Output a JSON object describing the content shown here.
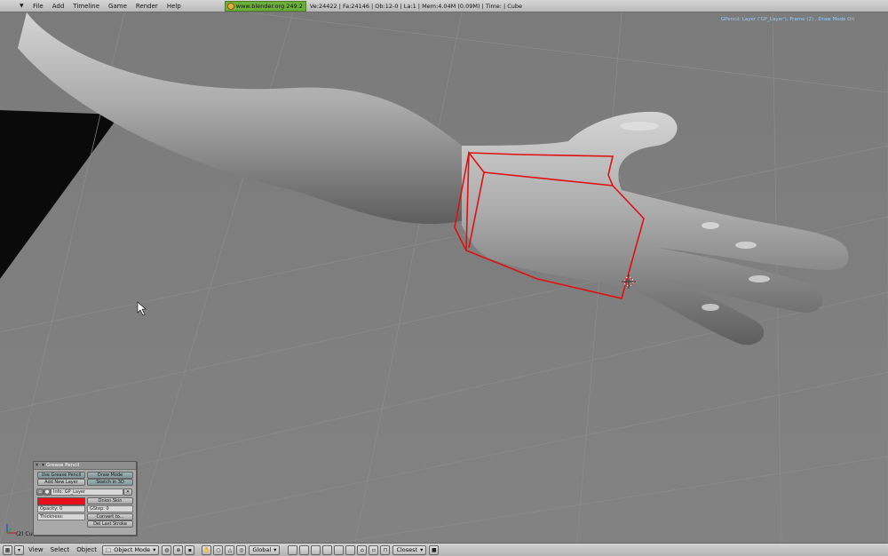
{
  "menu": {
    "items": [
      "File",
      "Add",
      "Timeline",
      "Game",
      "Render",
      "Help"
    ]
  },
  "status": {
    "url": "www.blender.org 249.2",
    "stats": "Ve:24422 | Fa:24146 | Ob:12-0 | La:1  | Mem:4.04M (0.09M)  | Time: | Cube"
  },
  "viewport": {
    "gp_info": "GPencil: Layer ('GP_Layer'), Frame (2) , Draw Mode On",
    "object_label": "(2) Cube",
    "annotation_color": "#e01010"
  },
  "gp_panel": {
    "title": "Grease Pencil",
    "use_label": "Use Grease Pencil",
    "draw_mode_label": "Draw Mode",
    "add_layer_label": "Add New Layer",
    "sketch_3d_label": "Sketch in 3D",
    "info_label": "Info: GP_Layer",
    "onion_skin_label": "Onion Skin",
    "opacity_label": "Opacity: 0",
    "gstep_label": "GStep: 0",
    "thickness_label": "Thickness: ",
    "convert_label": "Convert to...",
    "del_stroke_label": "Del Last Stroke",
    "stroke_color": "#e8101a"
  },
  "bottombar": {
    "view_label": "View",
    "select_label": "Select",
    "object_label": "Object",
    "mode_label": "Object Mode",
    "orientation_label": "Global",
    "snap_label": "Closest"
  }
}
